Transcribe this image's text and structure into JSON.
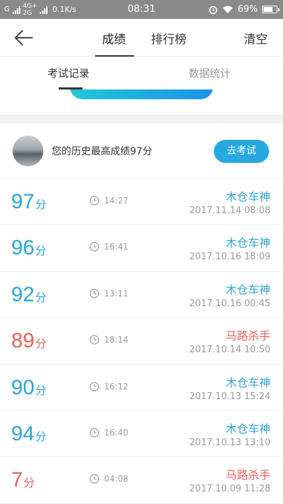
{
  "statusbar": {
    "carrier_left": "G",
    "network": "4G+",
    "network2": "2G",
    "speed": "0.1K/s",
    "time": "08:31",
    "battery": "69%"
  },
  "nav": {
    "tabs": [
      {
        "label": "成绩",
        "active": true
      },
      {
        "label": "排行榜",
        "active": false
      }
    ],
    "clear_label": "清空"
  },
  "subtabs": [
    {
      "label": "考试记录",
      "active": true
    },
    {
      "label": "数据统计",
      "active": false
    }
  ],
  "best": {
    "text": "您的历史最高成绩97分",
    "button_label": "去考试"
  },
  "records": [
    {
      "score": "97",
      "unit": "分",
      "duration": "14:27",
      "title": "木仓车神",
      "date": "2017.11.14  08:08",
      "color": "#2ba5d9"
    },
    {
      "score": "96",
      "unit": "分",
      "duration": "16:41",
      "title": "木仓车神",
      "date": "2017.10.16  18:09",
      "color": "#2ba5d9"
    },
    {
      "score": "92",
      "unit": "分",
      "duration": "13:11",
      "title": "木仓车神",
      "date": "2017.10.16  00:45",
      "color": "#2ba5d9"
    },
    {
      "score": "89",
      "unit": "分",
      "duration": "18:14",
      "title": "马路杀手",
      "date": "2017.10.14  10:50",
      "color": "#e5605a"
    },
    {
      "score": "90",
      "unit": "分",
      "duration": "16:12",
      "title": "木仓车神",
      "date": "2017.10.13  15:24",
      "color": "#2ba5d9"
    },
    {
      "score": "94",
      "unit": "分",
      "duration": "16:40",
      "title": "木仓车神",
      "date": "2017.10.13  13:10",
      "color": "#2ba5d9"
    },
    {
      "score": "7",
      "unit": "分",
      "duration": "04:08",
      "title": "马路杀手",
      "date": "2017.10.09  11:28",
      "color": "#e5605a"
    }
  ]
}
